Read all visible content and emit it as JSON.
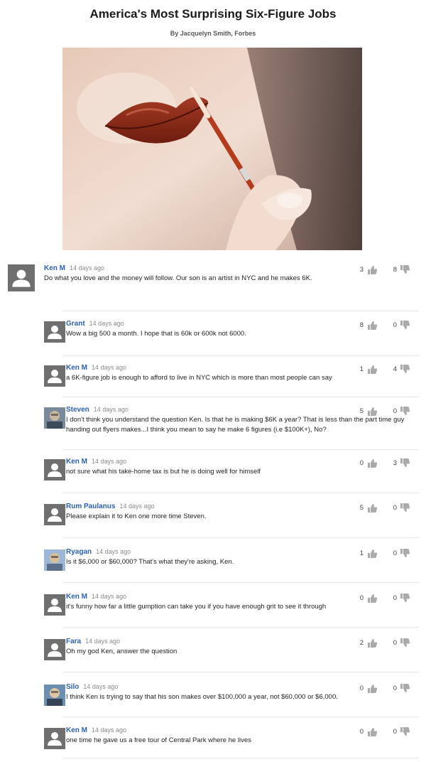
{
  "article": {
    "title": "America's Most Surprising Six-Figure Jobs",
    "byline": "By Jacquelyn Smith, Forbes"
  },
  "colors": {
    "author": "#2b5fb3",
    "vote_icon": "#aaaaaa"
  },
  "comments": [
    {
      "author": "Ken M",
      "time": "14 days ago",
      "text": "Do what you love and the money will follow. Our son is an artist in NYC and he makes 6K.",
      "up": "3",
      "down": "8",
      "avatar": "default-avatar"
    },
    {
      "author": "Grant",
      "time": "14 days ago",
      "text": "Wow a big 500 a month. I hope that is 60k or 600k not 6000.",
      "up": "8",
      "down": "0",
      "avatar": "default-avatar"
    },
    {
      "author": "Ken M",
      "time": "14 days ago",
      "text": "a 6K-figure job is enough to afford to live in NYC which is more than most people can say",
      "up": "1",
      "down": "4",
      "avatar": "default-avatar"
    },
    {
      "author": "Steven",
      "time": "14 days ago",
      "text": "I don't think you understand the question Ken. Is that he is making $6K a year? That is less than the part time guy handing out flyers makes...I think you mean to say he make 6 figures (i.e $100K+), No?",
      "up": "5",
      "down": "0",
      "avatar": "photo-avatar"
    },
    {
      "author": "Ken M",
      "time": "14 days ago",
      "text": "not sure what his take-home tax is but he is doing well for himself",
      "up": "0",
      "down": "3",
      "avatar": "default-avatar"
    },
    {
      "author": "Rum Paulanus",
      "time": "14 days ago",
      "text": "Please explain it to Ken one more time Steven.",
      "up": "5",
      "down": "0",
      "avatar": "default-avatar"
    },
    {
      "author": "Ryagan",
      "time": "14 days ago",
      "text": "Is it $6,000 or $60,000? That's what they're asking, Ken.",
      "up": "1",
      "down": "0",
      "avatar": "photo-avatar"
    },
    {
      "author": "Ken M",
      "time": "14 days ago",
      "text": "it's funny how far a little gumption can take you if you have enough grit to see it through",
      "up": "0",
      "down": "0",
      "avatar": "default-avatar"
    },
    {
      "author": "Fara",
      "time": "14 days ago",
      "text": "Oh my god Ken, answer the question",
      "up": "2",
      "down": "0",
      "avatar": "default-avatar"
    },
    {
      "author": "Silo",
      "time": "14 days ago",
      "text": "I think Ken is trying to say that his son makes over $100,000 a year, not $60,000 or $6,000.",
      "up": "0",
      "down": "0",
      "avatar": "photo-avatar"
    },
    {
      "author": "Ken M",
      "time": "14 days ago",
      "text": "one time he gave us a free tour of Central Park where he lives",
      "up": "0",
      "down": "0",
      "avatar": "default-avatar"
    }
  ]
}
